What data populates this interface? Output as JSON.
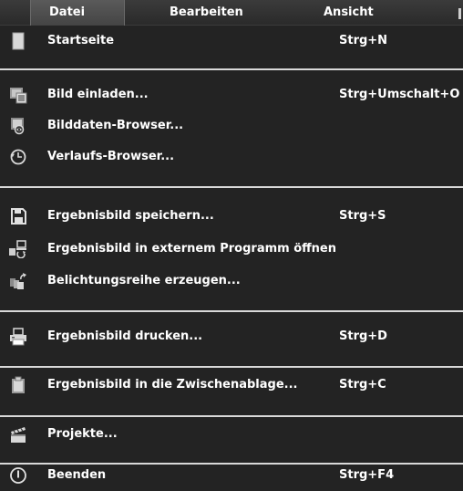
{
  "menubar": {
    "datei": "Datei",
    "bearbeiten": "Bearbeiten",
    "ansicht": "Ansicht"
  },
  "menu": {
    "startseite": {
      "label": "Startseite",
      "shortcut": "Strg+N",
      "icon": "page-icon"
    },
    "bild_einladen": {
      "label": "Bild einladen...",
      "shortcut": "Strg+Umschalt+O",
      "icon": "open-image-icon"
    },
    "bilddaten_browser": {
      "label": "Bilddaten-Browser...",
      "icon": "image-browser-icon"
    },
    "verlaufs_browser": {
      "label": "Verlaufs-Browser...",
      "icon": "history-icon"
    },
    "speichern": {
      "label": "Ergebnisbild speichern...",
      "shortcut": "Strg+S",
      "icon": "save-icon"
    },
    "extern": {
      "label": "Ergebnisbild in externem Programm öffnen",
      "icon": "external-program-icon"
    },
    "belichtungsreihe": {
      "label": "Belichtungsreihe erzeugen...",
      "icon": "bracketing-icon"
    },
    "drucken": {
      "label": "Ergebnisbild drucken...",
      "shortcut": "Strg+D",
      "icon": "printer-icon"
    },
    "zwischenablage": {
      "label": "Ergebnisbild in die Zwischenablage...",
      "shortcut": "Strg+C",
      "icon": "clipboard-icon"
    },
    "projekte": {
      "label": "Projekte...",
      "icon": "clapperboard-icon"
    },
    "beenden": {
      "label": "Beenden",
      "shortcut": "Strg+F4",
      "icon": "power-icon"
    }
  }
}
